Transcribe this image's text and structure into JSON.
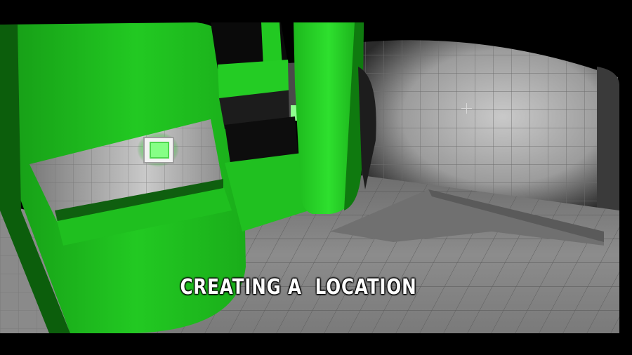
{
  "video": {
    "caption": "CREATING A  LOCATION"
  },
  "scene": {
    "accent_color": "#1fd11f",
    "floor_color": "#8a8a8a",
    "wall_color": "#b9b9b9",
    "light_panel_color": "#bfffbf"
  }
}
